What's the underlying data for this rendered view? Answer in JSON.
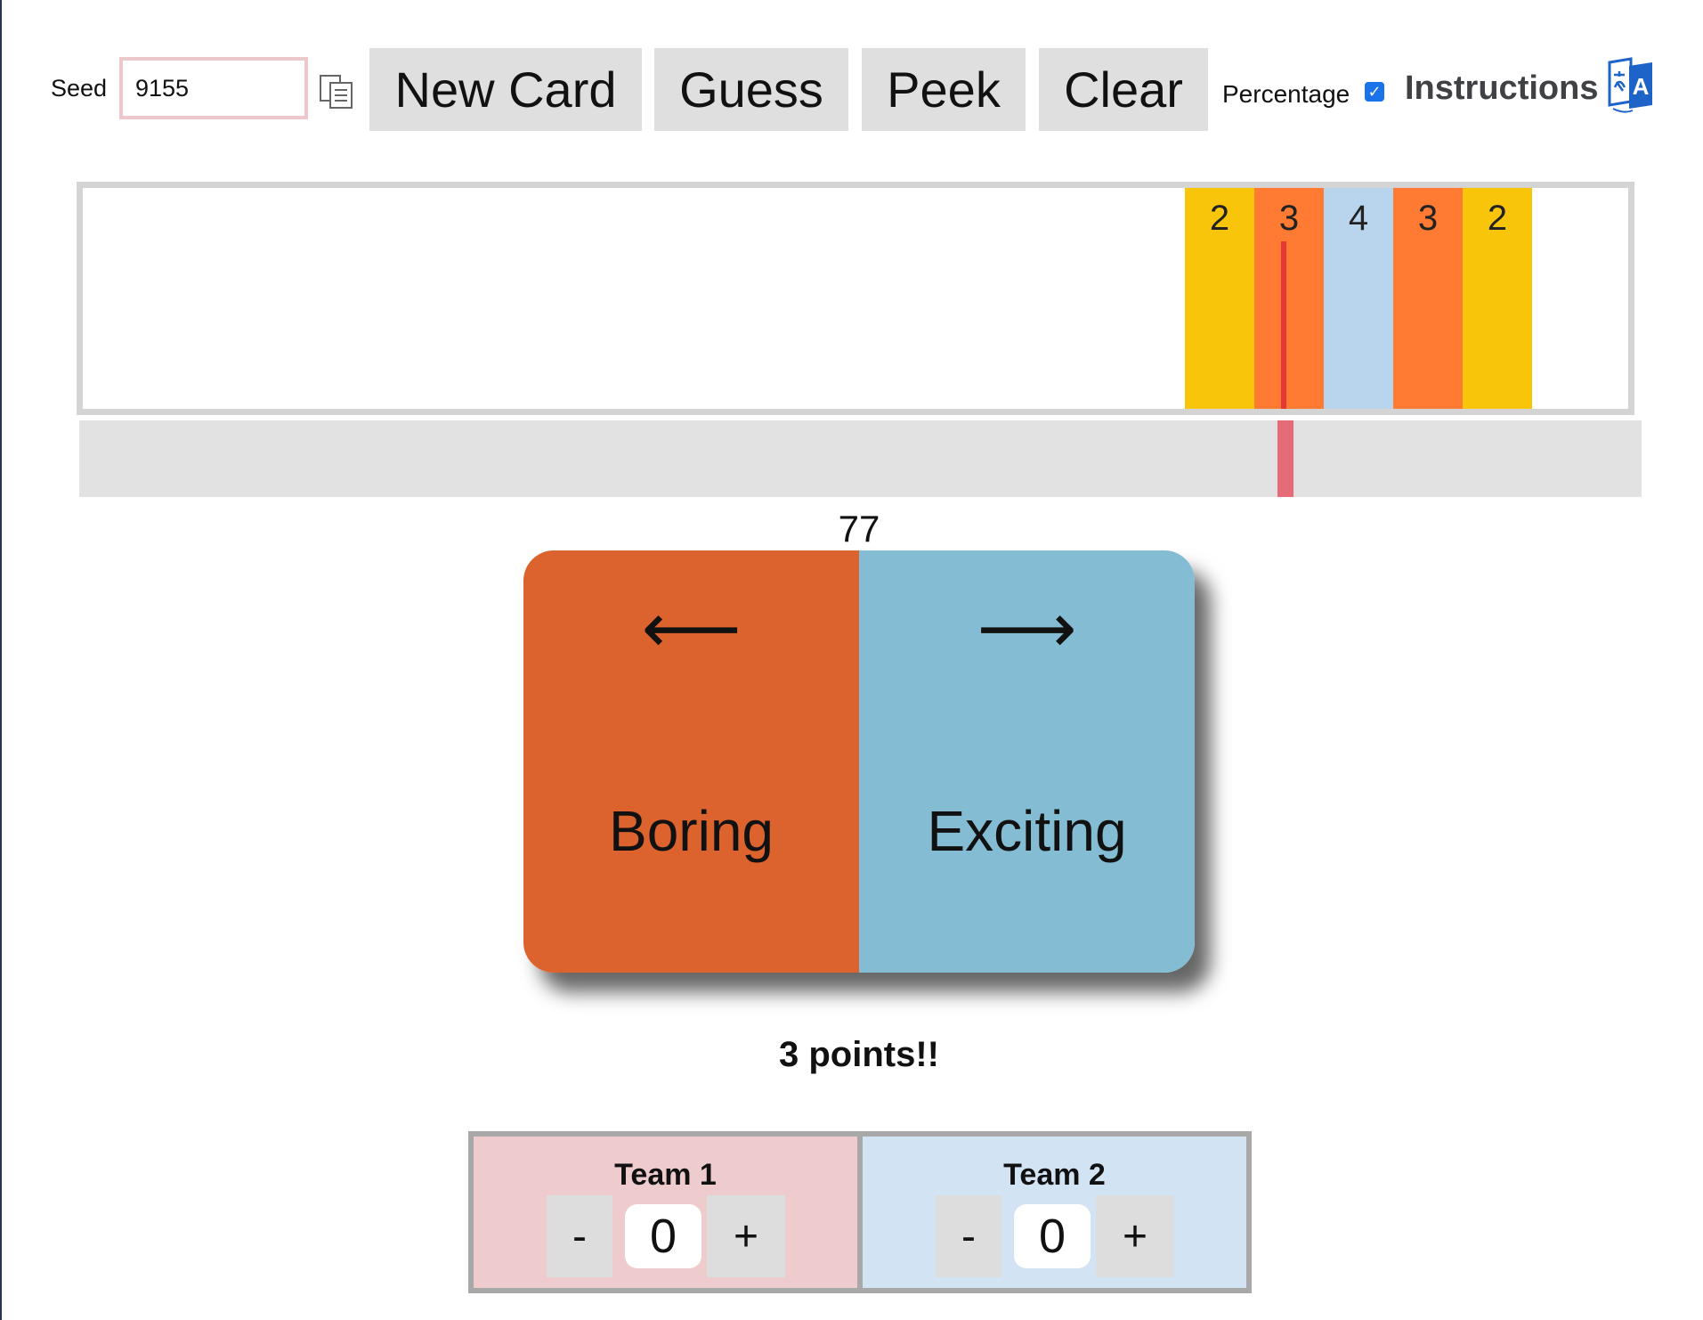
{
  "toolbar": {
    "seed_label": "Seed",
    "seed_value": "9155",
    "buttons": {
      "new_card": "New Card",
      "guess": "Guess",
      "peek": "Peek",
      "clear": "Clear"
    },
    "percentage_label": "Percentage",
    "percentage_checked": true,
    "check_mark": "✓",
    "instructions_label": "Instructions",
    "icons": {
      "copy": "copy-icon",
      "translate": "translate-icon"
    }
  },
  "dial": {
    "target_bands": [
      {
        "points": "2",
        "color": "#f9c50b"
      },
      {
        "points": "3",
        "color": "#ff7b33"
      },
      {
        "points": "4",
        "color": "#b9d5ee"
      },
      {
        "points": "3",
        "color": "#ff7b33"
      },
      {
        "points": "2",
        "color": "#f9c50b"
      }
    ],
    "needle_color": "#e53935",
    "slider_thumb_color": "#e56b78"
  },
  "value_readout": "77",
  "card": {
    "left": {
      "arrow": "⟵",
      "text": "Boring",
      "color": "#dc632d"
    },
    "right": {
      "arrow": "⟶",
      "text": "Exciting",
      "color": "#84bdd3"
    }
  },
  "result": "3 points!!",
  "teams": [
    {
      "name": "Team 1",
      "score": "0",
      "minus": "-",
      "plus": "+",
      "color": "#eecbcc"
    },
    {
      "name": "Team 2",
      "score": "0",
      "minus": "-",
      "plus": "+",
      "color": "#d2e3f4"
    }
  ]
}
